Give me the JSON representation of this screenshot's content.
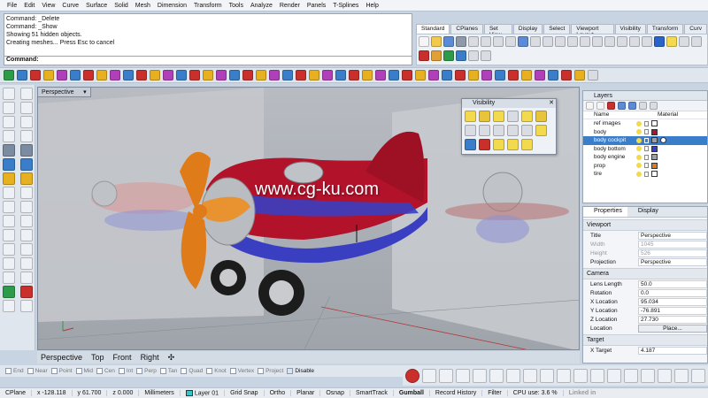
{
  "menubar": [
    "File",
    "Edit",
    "View",
    "Curve",
    "Surface",
    "Solid",
    "Mesh",
    "Dimension",
    "Transform",
    "Tools",
    "Analyze",
    "Render",
    "Panels",
    "T-Splines",
    "Help"
  ],
  "command_history": [
    "Command: _Delete",
    "Command: _Show",
    "Showing 51 hidden objects.",
    "Creating meshes... Press Esc to cancel"
  ],
  "command_prompt": "Command:",
  "toolbar_tabs": [
    "Standard",
    "CPlanes",
    "Set View",
    "Display",
    "Select",
    "Viewport Layout",
    "Visibility",
    "Transform",
    "Curv"
  ],
  "viewport": {
    "title": "Perspective",
    "watermark": "www.cg-ku.com"
  },
  "visibility_panel": {
    "title": "Visibility"
  },
  "view_tabs": [
    "Perspective",
    "Top",
    "Front",
    "Right"
  ],
  "osnap": [
    "End",
    "Near",
    "Point",
    "Mid",
    "Cen",
    "Int",
    "Perp",
    "Tan",
    "Quad",
    "Knot",
    "Vertex",
    "Project"
  ],
  "osnap_disable": "Disable",
  "layers": {
    "panel_title": "Layers",
    "col_name": "Name",
    "col_material": "Material",
    "rows": [
      {
        "name": "ref images",
        "color": "#ffffff"
      },
      {
        "name": "body",
        "color": "#b3122b"
      },
      {
        "name": "body cockpit",
        "color": "#9aa0a8",
        "selected": true
      },
      {
        "name": "body bottom",
        "color": "#3a3fc2"
      },
      {
        "name": "body engine",
        "color": "#9aa0a8"
      },
      {
        "name": "prop",
        "color": "#e07b1a"
      },
      {
        "name": "tire",
        "color": "#ffffff"
      }
    ]
  },
  "properties": {
    "tab_props": "Properties",
    "tab_display": "Display",
    "viewport_section": "Viewport",
    "title_label": "Title",
    "title_value": "Perspective",
    "width_label": "Width",
    "width_value": "1045",
    "height_label": "Height",
    "height_value": "526",
    "projection_label": "Projection",
    "projection_value": "Perspective",
    "camera_section": "Camera",
    "lens_label": "Lens Length",
    "lens_value": "50.0",
    "rotation_label": "Rotation",
    "rotation_value": "0.0",
    "xloc_label": "X Location",
    "xloc_value": "95.034",
    "yloc_label": "Y Location",
    "yloc_value": "-76.891",
    "zloc_label": "Z Location",
    "zloc_value": "27.730",
    "location_label": "Location",
    "location_button": "Place...",
    "target_section": "Target",
    "xtarget_label": "X Target",
    "xtarget_value": "4.187"
  },
  "status": {
    "cplane": "CPlane",
    "x": "x -128.118",
    "y": "y 61.700",
    "z": "z 0.000",
    "units": "Millimeters",
    "layer": "Layer 01",
    "grid_snap": "Grid Snap",
    "ortho": "Ortho",
    "planar": "Planar",
    "osnap": "Osnap",
    "smarttrack": "SmartTrack",
    "gumball": "Gumball",
    "record_history": "Record History",
    "filter": "Filter",
    "cpu": "CPU use: 3.6 %"
  },
  "brand": "Linked in"
}
